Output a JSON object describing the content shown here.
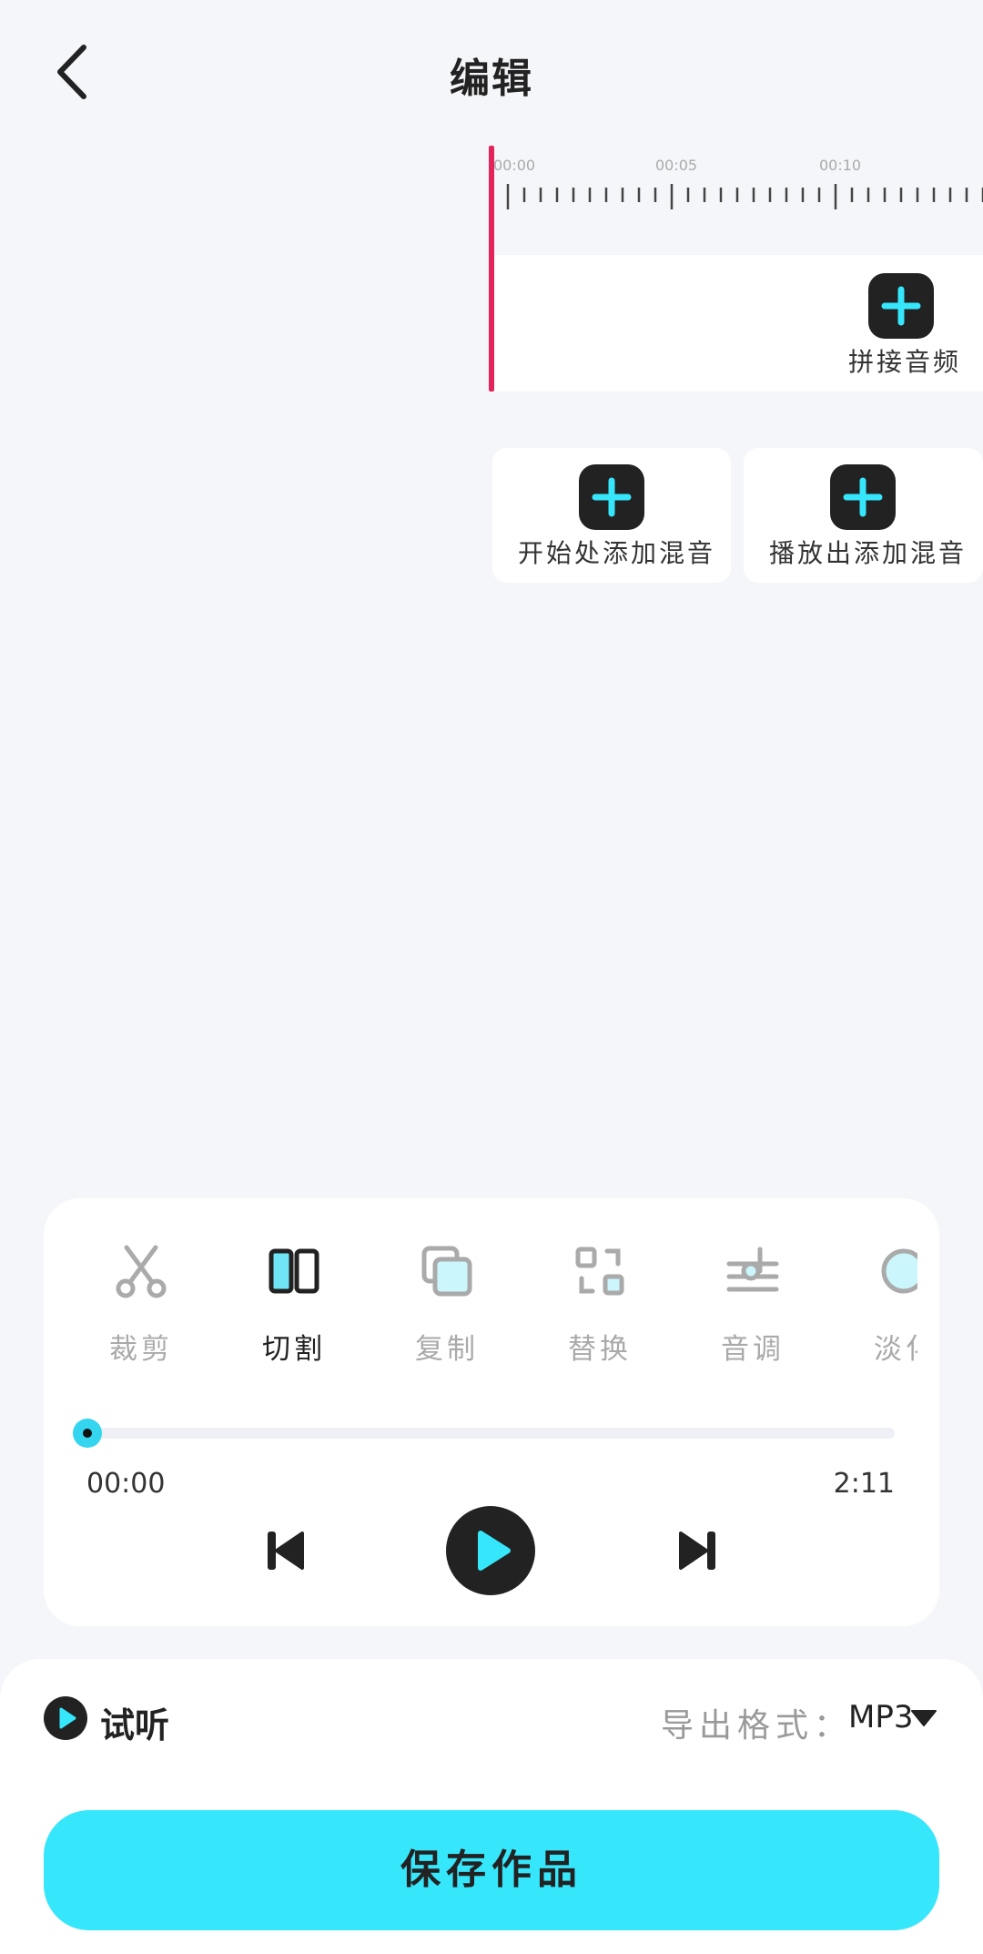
{
  "header": {
    "title": "编辑"
  },
  "timeline": {
    "tick_labels": [
      "00:00",
      "00:05",
      "00:10"
    ],
    "append_audio_label": "拼接音频",
    "mix_start_label": "开始处添加混音",
    "mix_playhead_label": "播放出添加混音"
  },
  "tools": [
    {
      "label": "裁剪",
      "icon": "scissors-icon",
      "active": false
    },
    {
      "label": "切割",
      "icon": "split-icon",
      "active": true
    },
    {
      "label": "复制",
      "icon": "copy-icon",
      "active": false
    },
    {
      "label": "替换",
      "icon": "replace-icon",
      "active": false
    },
    {
      "label": "音调",
      "icon": "pitch-icon",
      "active": false
    },
    {
      "label": "淡化",
      "icon": "fade-icon",
      "active": false
    }
  ],
  "player": {
    "current_time": "00:00",
    "total_time": "2:11",
    "progress": 0
  },
  "bottom": {
    "preview_label": "试听",
    "format_label": "导出格式：",
    "format_value": "MP3",
    "save_label": "保存作品"
  },
  "colors": {
    "accent": "#36e6fb",
    "playhead": "#e2245a",
    "dark": "#222222",
    "background": "#f5f6f9"
  }
}
